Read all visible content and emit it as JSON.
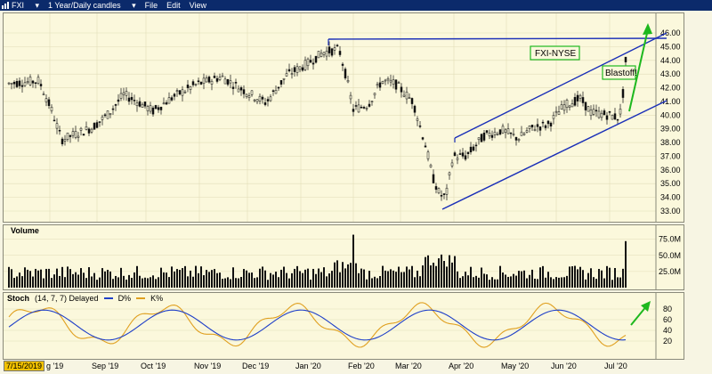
{
  "title_bar": {
    "symbol": "FXI",
    "timeframe": "1 Year/Daily candles",
    "menus": [
      "File",
      "Edit",
      "View"
    ]
  },
  "price_chart": {
    "annotations": {
      "label_fxi": "FXI-NYSE",
      "label_blastoff": "Blastoff!"
    },
    "y_ticks": [
      "46.00",
      "45.00",
      "44.00",
      "43.00",
      "42.00",
      "41.00",
      "40.00",
      "39.00",
      "38.00",
      "37.00",
      "36.00",
      "35.00",
      "34.00",
      "33.00"
    ]
  },
  "volume_chart": {
    "title": "Volume",
    "y_ticks": [
      "75.0M",
      "50.0M",
      "25.0M"
    ]
  },
  "stoch_chart": {
    "title": "Stoch",
    "params": "(14, 7, 7) Delayed",
    "legend_d": "D%",
    "legend_k": "K%",
    "y_ticks": [
      "80",
      "60",
      "40",
      "20"
    ]
  },
  "x_axis": {
    "start_date": "7/15/2019",
    "labels": [
      "g '19",
      "Sep '19",
      "Oct '19",
      "Nov '19",
      "Dec '19",
      "Jan '20",
      "Feb '20",
      "Mar '20",
      "Apr '20",
      "May '20",
      "Jun '20",
      "Jul '20"
    ]
  },
  "colors": {
    "title_bar": "#0b2a6b",
    "background": "#fbf8dc",
    "channel_line": "#1a2fb8",
    "arrow": "#1eb81e",
    "stoch_d": "#2040c8",
    "stoch_k": "#e0a020",
    "date_highlight": "#f2c200"
  }
}
